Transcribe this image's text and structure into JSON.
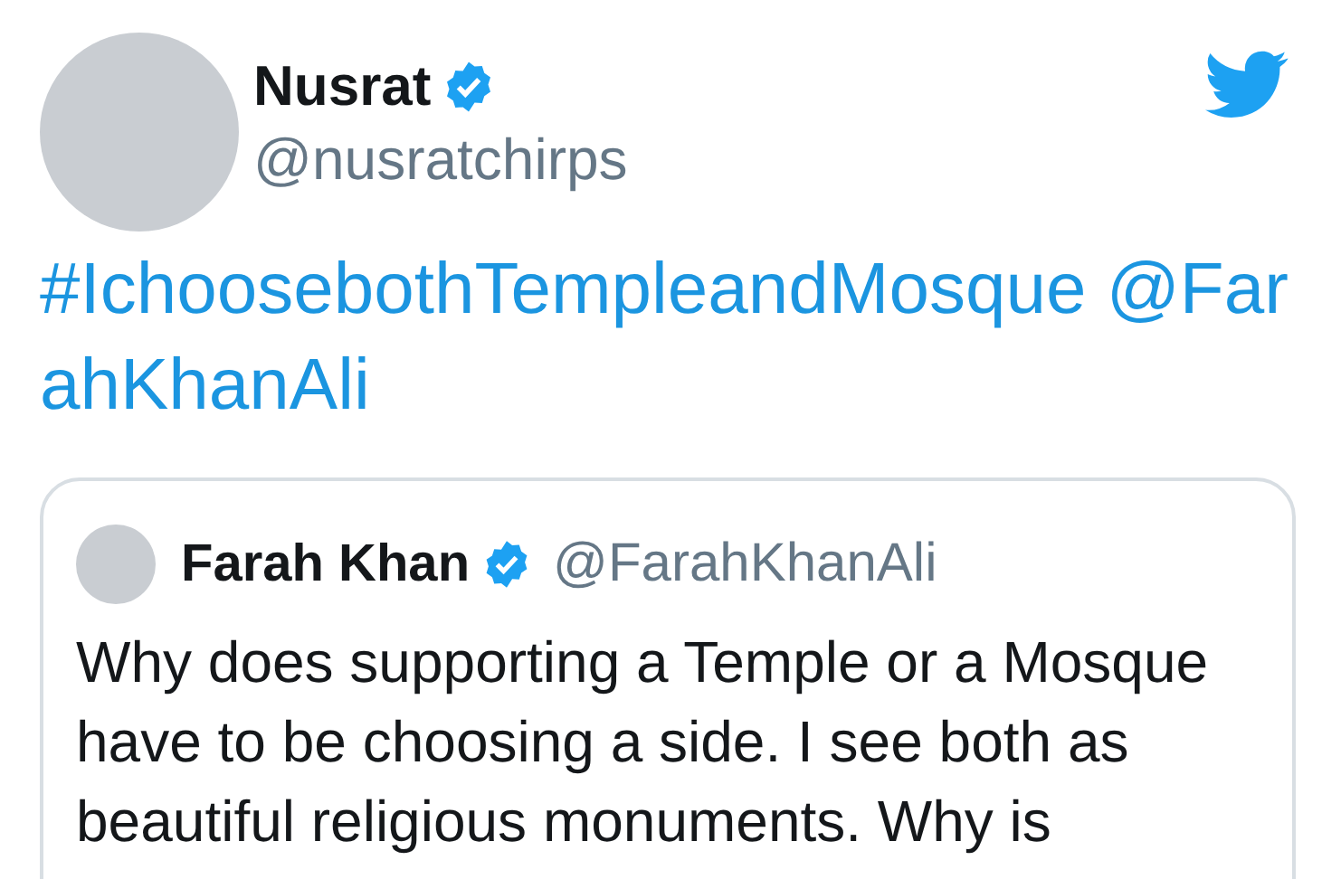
{
  "tweet": {
    "author": {
      "name": "Nusrat",
      "verified": true,
      "handle": "@nusratchirps"
    },
    "hashtag": "#IchoosebothTempleandMosque",
    "mention": "@FarahKhanAli",
    "quoted": {
      "author": {
        "name": "Farah Khan",
        "verified": true,
        "handle": "@FarahKhanAli"
      },
      "body_lines": [
        "Why does supporting a Temple or a Mosque",
        "have to be choosing a side. I see both as",
        "beautiful religious monuments. Why is"
      ]
    }
  }
}
